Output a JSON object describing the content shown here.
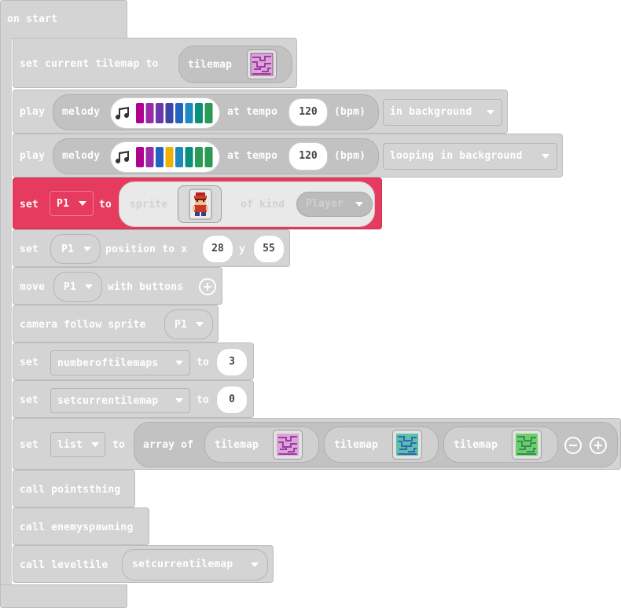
{
  "event": {
    "label": "on start"
  },
  "blocks": {
    "set_tilemap": {
      "keyword": "set current tilemap to",
      "arg_label": "tilemap",
      "thumb_icon": "pink-maze-tilemap"
    },
    "play1": {
      "keyword": "play",
      "melody_label": "melody",
      "tempo_label": "at tempo",
      "tempo": "120",
      "unit": "(bpm)",
      "mode": "in background",
      "notes": [
        "#b00090",
        "#9a2aa8",
        "#6a38a8",
        "#3f46a8",
        "#2265c0",
        "#1e88c0",
        "#0b8f7a",
        "#2a9a55"
      ]
    },
    "play2": {
      "keyword": "play",
      "melody_label": "melody",
      "tempo_label": "at tempo",
      "tempo": "120",
      "unit": "(bpm)",
      "mode": "looping in background",
      "notes": [
        "#b00090",
        "#9a2aa8",
        "#2265c0",
        "#f0b000",
        "#1e88c0",
        "#0b8f7a",
        "#2a9a55",
        "#2a9a55"
      ]
    },
    "set_sprite": {
      "keyword": "set",
      "var": "P1",
      "to": "to",
      "sprite_label": "sprite",
      "kind_label": "of kind",
      "kind": "Player",
      "sprite_icon": "player-sprite"
    },
    "set_pos": {
      "keyword": "set",
      "var": "P1",
      "pos_label": "position to x",
      "x": "28",
      "y_label": "y",
      "y": "55"
    },
    "move": {
      "keyword": "move",
      "var": "P1",
      "with": "with buttons"
    },
    "camera": {
      "keyword": "camera follow sprite",
      "var": "P1"
    },
    "set_num": {
      "keyword": "set",
      "var": "numberoftilemaps",
      "to": "to",
      "value": "3"
    },
    "set_cur": {
      "keyword": "set",
      "var": "setcurrentilemap",
      "to": "to",
      "value": "0"
    },
    "set_list": {
      "keyword": "set",
      "var": "list",
      "to": "to",
      "array_label": "array of",
      "items": [
        "tilemap",
        "tilemap",
        "tilemap"
      ],
      "thumbs": [
        "pink-maze-tilemap",
        "teal-maze-tilemap",
        "green-maze-tilemap"
      ]
    },
    "call1": {
      "label": "call pointsthing"
    },
    "call2": {
      "label": "call enemyspawning"
    },
    "call3": {
      "keyword": "call leveltile",
      "var": "setcurrentilemap"
    }
  },
  "colors": {
    "block_gray": "#d4d4d4",
    "sprite_red": "#e63a5e"
  }
}
